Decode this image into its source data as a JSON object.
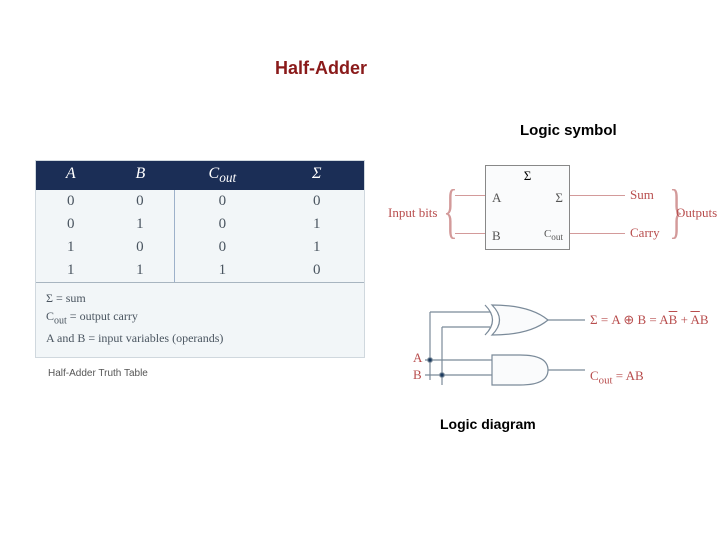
{
  "title": "Half-Adder",
  "labels": {
    "logic_symbol": "Logic symbol",
    "logic_diagram": "Logic diagram"
  },
  "truth_table": {
    "headers": {
      "a": "A",
      "b": "B",
      "cout": "C",
      "cout_sub": "out",
      "sigma": "Σ"
    },
    "rows": [
      {
        "a": "0",
        "b": "0",
        "c": "0",
        "s": "0"
      },
      {
        "a": "0",
        "b": "1",
        "c": "0",
        "s": "1"
      },
      {
        "a": "1",
        "b": "0",
        "c": "0",
        "s": "1"
      },
      {
        "a": "1",
        "b": "1",
        "c": "1",
        "s": "0"
      }
    ],
    "legend": {
      "l1": "Σ = sum",
      "l2_a": "C",
      "l2_sub": "out",
      "l2_b": " = output carry",
      "l3": "A and B = input variables (operands)"
    },
    "caption": "Half-Adder Truth Table"
  },
  "symbol": {
    "sigma_top": "Σ",
    "inA": "A",
    "inB": "B",
    "outS": "Σ",
    "outC": "C",
    "outC_sub": "out",
    "input_bits": "Input bits",
    "sum": "Sum",
    "carry": "Carry",
    "outputs": "Outputs"
  },
  "gates": {
    "inA": "A",
    "inB": "B",
    "sigma_eq_pre": "Σ = A ⊕ B = A",
    "Bbar": "B",
    "plus": " + ",
    "Abar": "A",
    "postB": "B",
    "cout_eq_a": "C",
    "cout_eq_sub": "out",
    "cout_eq_b": " = AB"
  },
  "chart_data": {
    "type": "table",
    "title": "Half-Adder Truth Table",
    "columns": [
      "A",
      "B",
      "Cout",
      "Σ"
    ],
    "rows": [
      [
        0,
        0,
        0,
        0
      ],
      [
        0,
        1,
        0,
        1
      ],
      [
        1,
        0,
        0,
        1
      ],
      [
        1,
        1,
        1,
        0
      ]
    ],
    "equations": {
      "sum": "Σ = A ⊕ B = A·B̄ + Ā·B",
      "carry": "Cout = A·B"
    }
  }
}
